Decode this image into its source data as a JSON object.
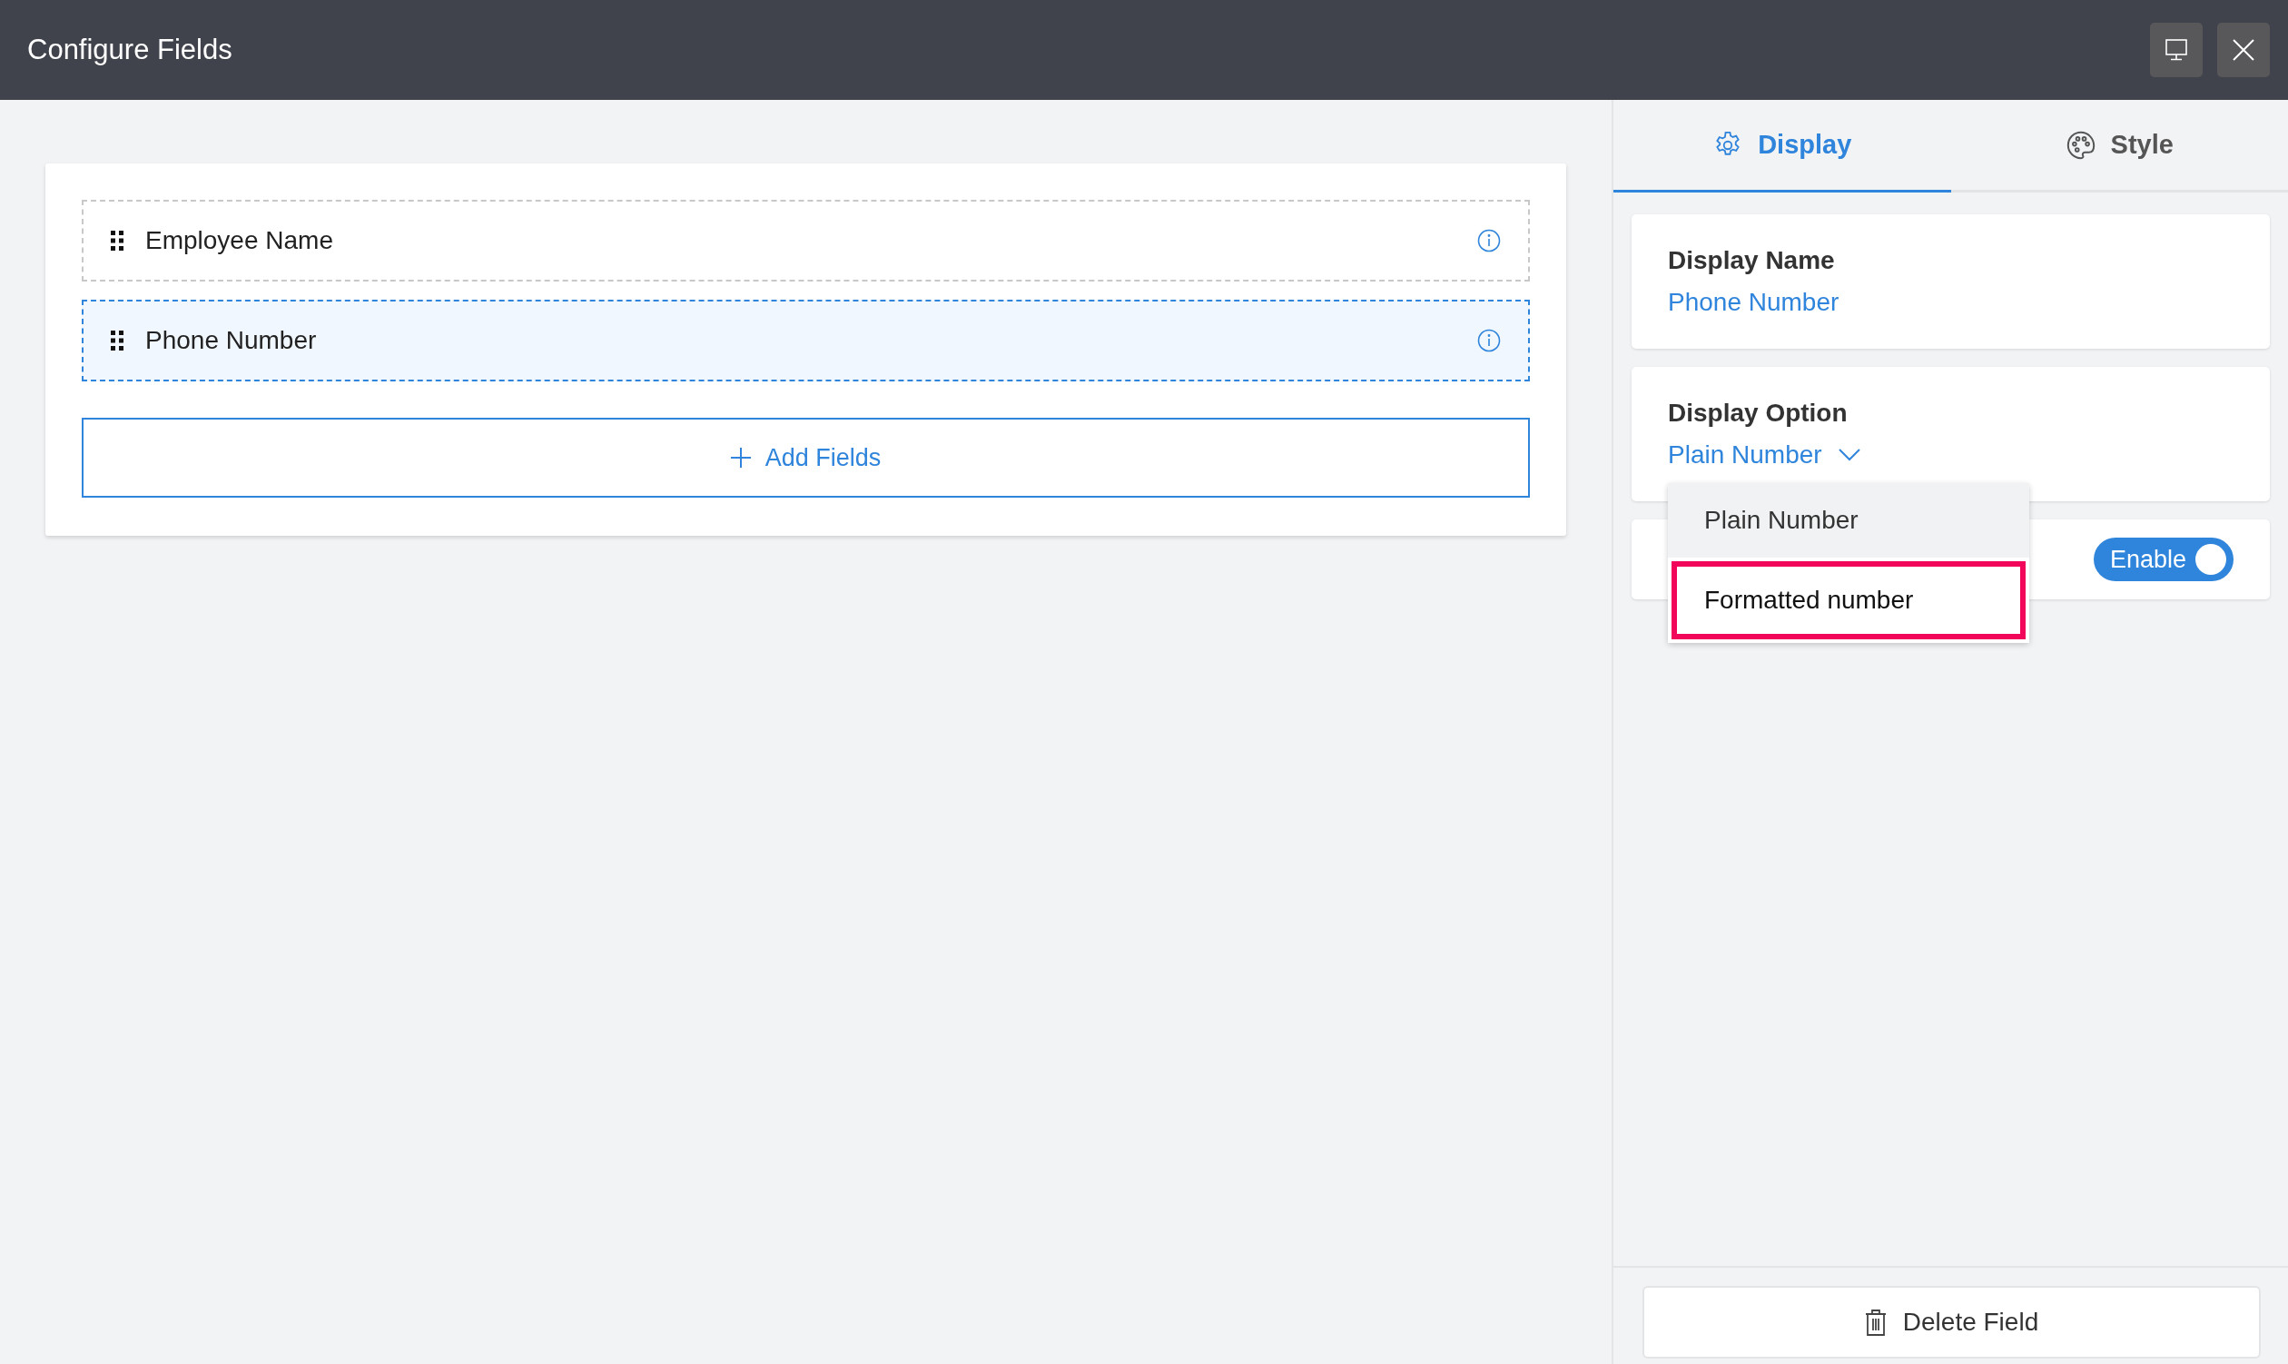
{
  "window": {
    "title": "Configure Fields",
    "buttons": [
      {
        "kind": "monitor"
      },
      {
        "kind": "close"
      }
    ]
  },
  "fields": [
    {
      "label": "Employee Name",
      "selected": false
    },
    {
      "label": "Phone Number",
      "selected": true
    }
  ],
  "add_button": {
    "label": "Add Fields"
  },
  "tabs": [
    {
      "label": "Display",
      "kind": "gear",
      "selected": true
    },
    {
      "label": "Style",
      "kind": "palette",
      "selected": false
    }
  ],
  "display_name": {
    "label": "Display Name",
    "value": "Phone Number"
  },
  "display_option": {
    "label": "Display Option",
    "value": "Plain Number",
    "expanded": true,
    "options": [
      {
        "label": "Plain Number",
        "selected": true,
        "highlighted": false
      },
      {
        "label": "Formatted number",
        "selected": false,
        "highlighted": true
      }
    ]
  },
  "toggle": {
    "label": "Enable",
    "on": true
  },
  "delete_button": {
    "label": "Delete Field"
  }
}
